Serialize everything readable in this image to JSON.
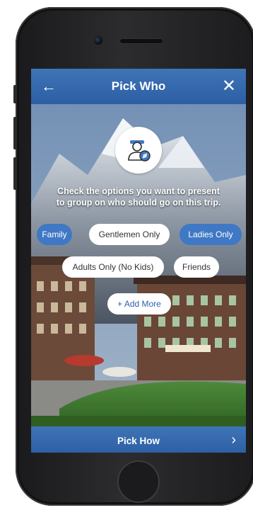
{
  "header": {
    "back_glyph": "←",
    "title": "Pick Who",
    "close_glyph": "✕"
  },
  "prompt": {
    "line1": "Check the options you want to present",
    "line2": "to group on who should go on this trip."
  },
  "chips": {
    "family": "Family",
    "gentlemen": "Gentlemen Only",
    "ladies": "Ladies Only",
    "adults": "Adults Only (No Kids)",
    "friends": "Friends",
    "add_more": "+ Add More"
  },
  "selected_options": [
    "Family",
    "Ladies Only"
  ],
  "footer": {
    "label": "Pick How",
    "chevron_glyph": "›"
  },
  "icons": [
    "arrow-left-icon",
    "close-icon",
    "traveler-icon",
    "chevron-right-icon"
  ],
  "colors": {
    "accent": "#3f78c4",
    "header_bg": "#3f74b7",
    "chip_selected": "#3f78c4",
    "chip_unselected": "#ffffff"
  }
}
